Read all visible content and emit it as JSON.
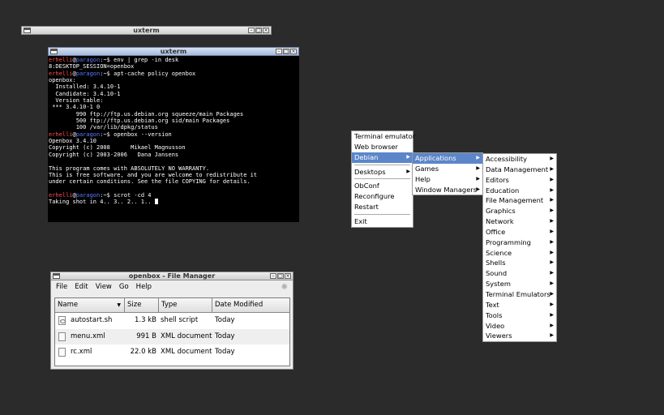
{
  "windows": {
    "uxterm_small": {
      "title": "uxterm"
    },
    "uxterm_main": {
      "title": "uxterm",
      "terminal": {
        "user": "erhelli",
        "host": "paragon",
        "prompt_suffix": ":~$ ",
        "lines": [
          {
            "type": "cmd",
            "text": "env | grep -in desk"
          },
          {
            "type": "out",
            "text": "8:DESKTOP_SESSION=openbox"
          },
          {
            "type": "cmd",
            "text": "apt-cache policy openbox"
          },
          {
            "type": "out",
            "text": "openbox:"
          },
          {
            "type": "out",
            "text": "  Installed: 3.4.10-1"
          },
          {
            "type": "out",
            "text": "  Candidate: 3.4.10-1"
          },
          {
            "type": "out",
            "text": "  Version table:"
          },
          {
            "type": "out",
            "text": " *** 3.4.10-1 0"
          },
          {
            "type": "out",
            "text": "        990 ftp://ftp.us.debian.org squeeze/main Packages"
          },
          {
            "type": "out",
            "text": "        500 ftp://ftp.us.debian.org sid/main Packages"
          },
          {
            "type": "out",
            "text": "        100 /var/lib/dpkg/status"
          },
          {
            "type": "cmd",
            "text": "openbox --version"
          },
          {
            "type": "out",
            "text": "Openbox 3.4.10"
          },
          {
            "type": "out",
            "text": "Copyright (c) 2008      Mikael Magnusson"
          },
          {
            "type": "out",
            "text": "Copyright (c) 2003-2006   Dana Jansens"
          },
          {
            "type": "out",
            "text": ""
          },
          {
            "type": "out",
            "text": "This program comes with ABSOLUTELY NO WARRANTY."
          },
          {
            "type": "out",
            "text": "This is free software, and you are welcome to redistribute it"
          },
          {
            "type": "out",
            "text": "under certain conditions. See the file COPYING for details."
          },
          {
            "type": "out",
            "text": ""
          },
          {
            "type": "cmd",
            "text": "scrot -cd 4"
          },
          {
            "type": "cursor",
            "text": "Taking shot in 4.. 3.. 2.. 1.. "
          }
        ]
      }
    },
    "file_manager": {
      "title": "openbox - File Manager",
      "menu": [
        "File",
        "Edit",
        "View",
        "Go",
        "Help"
      ],
      "columns": [
        "Name",
        "Size",
        "Type",
        "Date Modified"
      ],
      "rows": [
        {
          "name": "autostart.sh",
          "size": "1.3 kB",
          "type": "shell script",
          "date": "Today",
          "icon": "shell-script-icon"
        },
        {
          "name": "menu.xml",
          "size": "991 B",
          "type": "XML document",
          "date": "Today",
          "icon": "document-icon"
        },
        {
          "name": "rc.xml",
          "size": "22.0 kB",
          "type": "XML document",
          "date": "Today",
          "icon": "document-icon"
        }
      ]
    }
  },
  "root_menu": {
    "items": [
      {
        "label": "Terminal emulator",
        "submenu": false
      },
      {
        "label": "Web browser",
        "submenu": false
      },
      {
        "label": "Debian",
        "submenu": true,
        "selected": true
      },
      {
        "sep": true
      },
      {
        "label": "Desktops",
        "submenu": true
      },
      {
        "sep": true
      },
      {
        "label": "ObConf",
        "submenu": false
      },
      {
        "label": "Reconfigure",
        "submenu": false
      },
      {
        "label": "Restart",
        "submenu": false
      },
      {
        "sep": true
      },
      {
        "label": "Exit",
        "submenu": false
      }
    ]
  },
  "debian_menu": {
    "items": [
      {
        "label": "Applications",
        "submenu": true,
        "selected": true
      },
      {
        "label": "Games",
        "submenu": true
      },
      {
        "label": "Help",
        "submenu": true
      },
      {
        "label": "Window Managers",
        "submenu": true
      }
    ]
  },
  "applications_menu": {
    "items": [
      "Accessibility",
      "Data Management",
      "Editors",
      "Education",
      "File Management",
      "Graphics",
      "Network",
      "Office",
      "Programming",
      "Science",
      "Shells",
      "Sound",
      "System",
      "Terminal Emulators",
      "Text",
      "Tools",
      "Video",
      "Viewers"
    ]
  },
  "colors": {
    "desktop": "#2b2b2b",
    "selection": "#5c86c9",
    "prompt_user": "#ff4d4d",
    "prompt_host": "#5a7bff"
  }
}
